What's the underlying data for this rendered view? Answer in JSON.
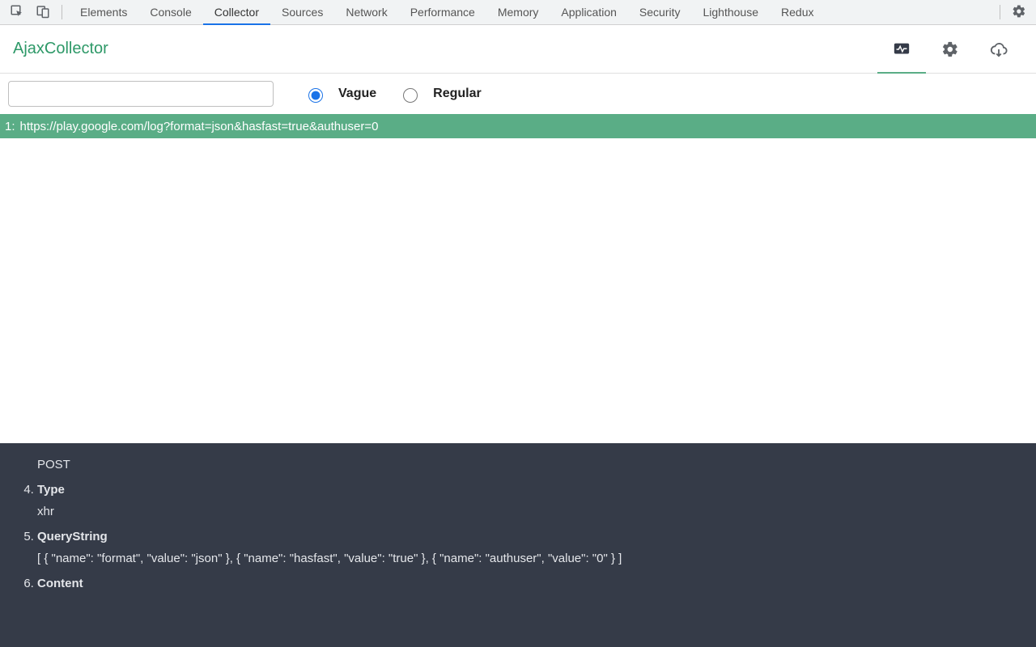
{
  "tabstrip": {
    "tabs": [
      {
        "label": "Elements"
      },
      {
        "label": "Console"
      },
      {
        "label": "Collector",
        "active": true
      },
      {
        "label": "Sources"
      },
      {
        "label": "Network"
      },
      {
        "label": "Performance"
      },
      {
        "label": "Memory"
      },
      {
        "label": "Application"
      },
      {
        "label": "Security"
      },
      {
        "label": "Lighthouse"
      },
      {
        "label": "Redux"
      }
    ]
  },
  "app": {
    "title": "AjaxCollector"
  },
  "filter": {
    "value": "",
    "placeholder": "",
    "radios": [
      {
        "label": "Vague",
        "checked": true
      },
      {
        "label": "Regular",
        "checked": false
      }
    ]
  },
  "requests": [
    {
      "index": "1:",
      "url": "https://play.google.com/log?format=json&hasfast=true&authuser=0"
    }
  ],
  "details": {
    "leading_value": "POST",
    "start_index": 4,
    "items": [
      {
        "key": "Type",
        "value": "xhr"
      },
      {
        "key": "QueryString",
        "value": "[ { \"name\": \"format\", \"value\": \"json\" }, { \"name\": \"hasfast\", \"value\": \"true\" }, { \"name\": \"authuser\", \"value\": \"0\" } ]"
      },
      {
        "key": "Content",
        "value": ""
      }
    ]
  }
}
